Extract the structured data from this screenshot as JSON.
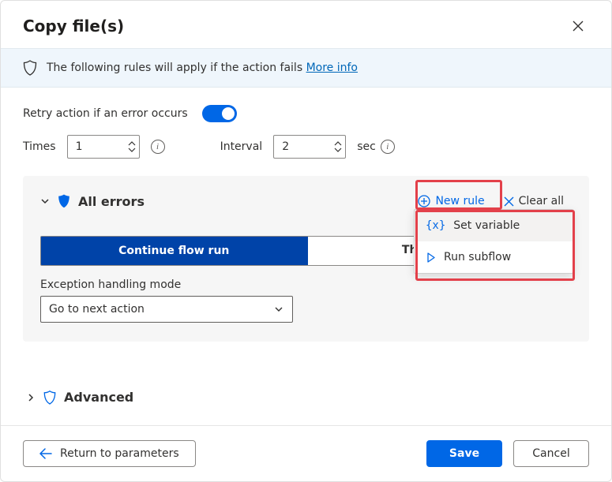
{
  "header": {
    "title": "Copy file(s)"
  },
  "info_banner": {
    "text": "The following rules will apply if the action fails ",
    "link": "More info"
  },
  "retry": {
    "label": "Retry action if an error occurs",
    "enabled": true,
    "times_label": "Times",
    "times_value": "1",
    "interval_label": "Interval",
    "interval_value": "2",
    "unit": "sec"
  },
  "errors": {
    "title": "All errors",
    "new_rule_label": "New rule",
    "clear_all_label": "Clear all",
    "continue_label": "Continue flow run",
    "throw_label": "Throw error",
    "mode_label": "Exception handling mode",
    "mode_value": "Go to next action",
    "dropdown": [
      {
        "label": "Set variable"
      },
      {
        "label": "Run subflow"
      }
    ]
  },
  "advanced": {
    "label": "Advanced"
  },
  "footer": {
    "return_label": "Return to parameters",
    "save_label": "Save",
    "cancel_label": "Cancel"
  }
}
